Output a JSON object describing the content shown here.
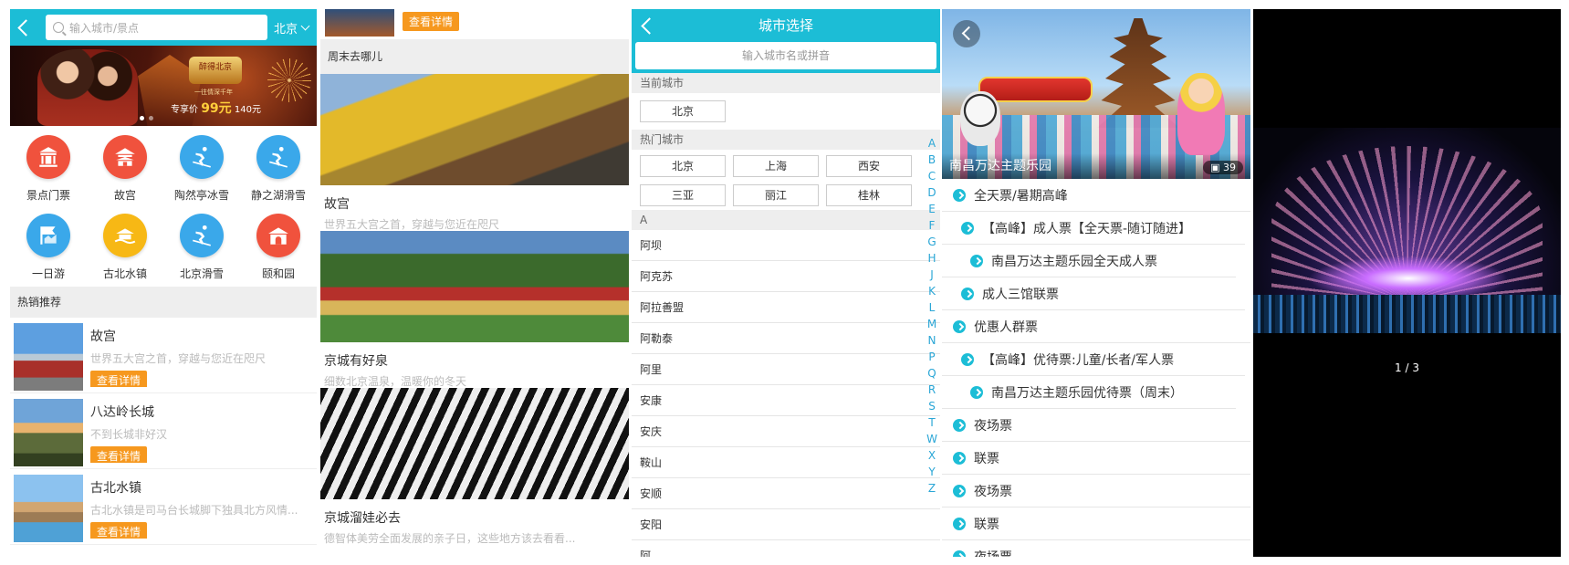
{
  "panel1": {
    "search_placeholder": "输入城市/景点",
    "city": "北京",
    "banner": {
      "badge": "醉得北京",
      "sub": "一往情深千年",
      "price_prefix": "专享价",
      "price": "99元",
      "original": "140元"
    },
    "icons": [
      {
        "label": "景点门票",
        "icon": "ticket-gate-icon",
        "color": "#f0523d"
      },
      {
        "label": "故宫",
        "icon": "palace-icon",
        "color": "#f0523d"
      },
      {
        "label": "陶然亭冰雪",
        "icon": "skier-icon",
        "color": "#3aa8ea"
      },
      {
        "label": "静之湖滑雪",
        "icon": "skier-icon",
        "color": "#3aa8ea"
      },
      {
        "label": "一日游",
        "icon": "flag-map-icon",
        "color": "#3aa8ea"
      },
      {
        "label": "古北水镇",
        "icon": "water-town-icon",
        "color": "#f7b815"
      },
      {
        "label": "北京滑雪",
        "icon": "skier-icon",
        "color": "#3aa8ea"
      },
      {
        "label": "颐和园",
        "icon": "garden-icon",
        "color": "#f0523d"
      }
    ],
    "hot_title": "热销推荐",
    "recommendations": [
      {
        "title": "故宫",
        "desc": "世界五大宫之首，穿越与您近在咫尺",
        "button": "查看详情"
      },
      {
        "title": "八达岭长城",
        "desc": "不到长城非好汉",
        "button": "查看详情"
      },
      {
        "title": "古北水镇",
        "desc": "古北水镇是司马台长城脚下独具北方风情...",
        "button": "查看详情"
      }
    ]
  },
  "panel2": {
    "top_button": "查看详情",
    "section_title": "周末去哪儿",
    "cards": [
      {
        "title": "故宫",
        "desc": "世界五大宫之首，穿越与您近在咫尺"
      },
      {
        "title": "京城有好泉",
        "desc": "细数北京温泉，温暖你的冬天"
      },
      {
        "title": "京城溜娃必去",
        "desc": "德智体美劳全面发展的亲子日，这些地方该去看看..."
      }
    ]
  },
  "panel3": {
    "title": "城市选择",
    "search_placeholder": "输入城市名或拼音",
    "current_label": "当前城市",
    "current_city": "北京",
    "hot_label": "热门城市",
    "hot_cities": [
      "北京",
      "上海",
      "西安",
      "三亚",
      "丽江",
      "桂林"
    ],
    "group_letter": "A",
    "cities": [
      "阿坝",
      "阿克苏",
      "阿拉善盟",
      "阿勒泰",
      "阿里",
      "安康",
      "安庆",
      "鞍山",
      "安顺",
      "安阳",
      "阿..."
    ],
    "index_letters": [
      "A",
      "B",
      "C",
      "D",
      "E",
      "F",
      "G",
      "H",
      "J",
      "K",
      "L",
      "M",
      "N",
      "P",
      "Q",
      "R",
      "S",
      "T",
      "W",
      "X",
      "Y",
      "Z"
    ]
  },
  "panel4": {
    "caption": "南昌万达主题乐园",
    "photo_count": "39",
    "tickets": [
      {
        "label": "全天票/暑期高峰",
        "level": 0
      },
      {
        "label": "【高峰】成人票【全天票-随订随进】",
        "level": 1
      },
      {
        "label": "南昌万达主题乐园全天成人票",
        "level": 2
      },
      {
        "label": "成人三馆联票",
        "level": 1
      },
      {
        "label": "优惠人群票",
        "level": 0
      },
      {
        "label": "【高峰】优待票:儿童/长者/军人票",
        "level": 1
      },
      {
        "label": "南昌万达主题乐园优待票（周末）",
        "level": 2
      },
      {
        "label": "夜场票",
        "level": 0
      },
      {
        "label": "联票",
        "level": 0
      },
      {
        "label": "夜场票",
        "level": 0
      },
      {
        "label": "联票",
        "level": 0
      },
      {
        "label": "夜场票",
        "level": 0
      }
    ]
  },
  "panel5": {
    "pager": "1 / 3"
  },
  "colors": {
    "accent": "#1cbdd6",
    "button": "#f6981e",
    "index": "#2aa6d6"
  }
}
